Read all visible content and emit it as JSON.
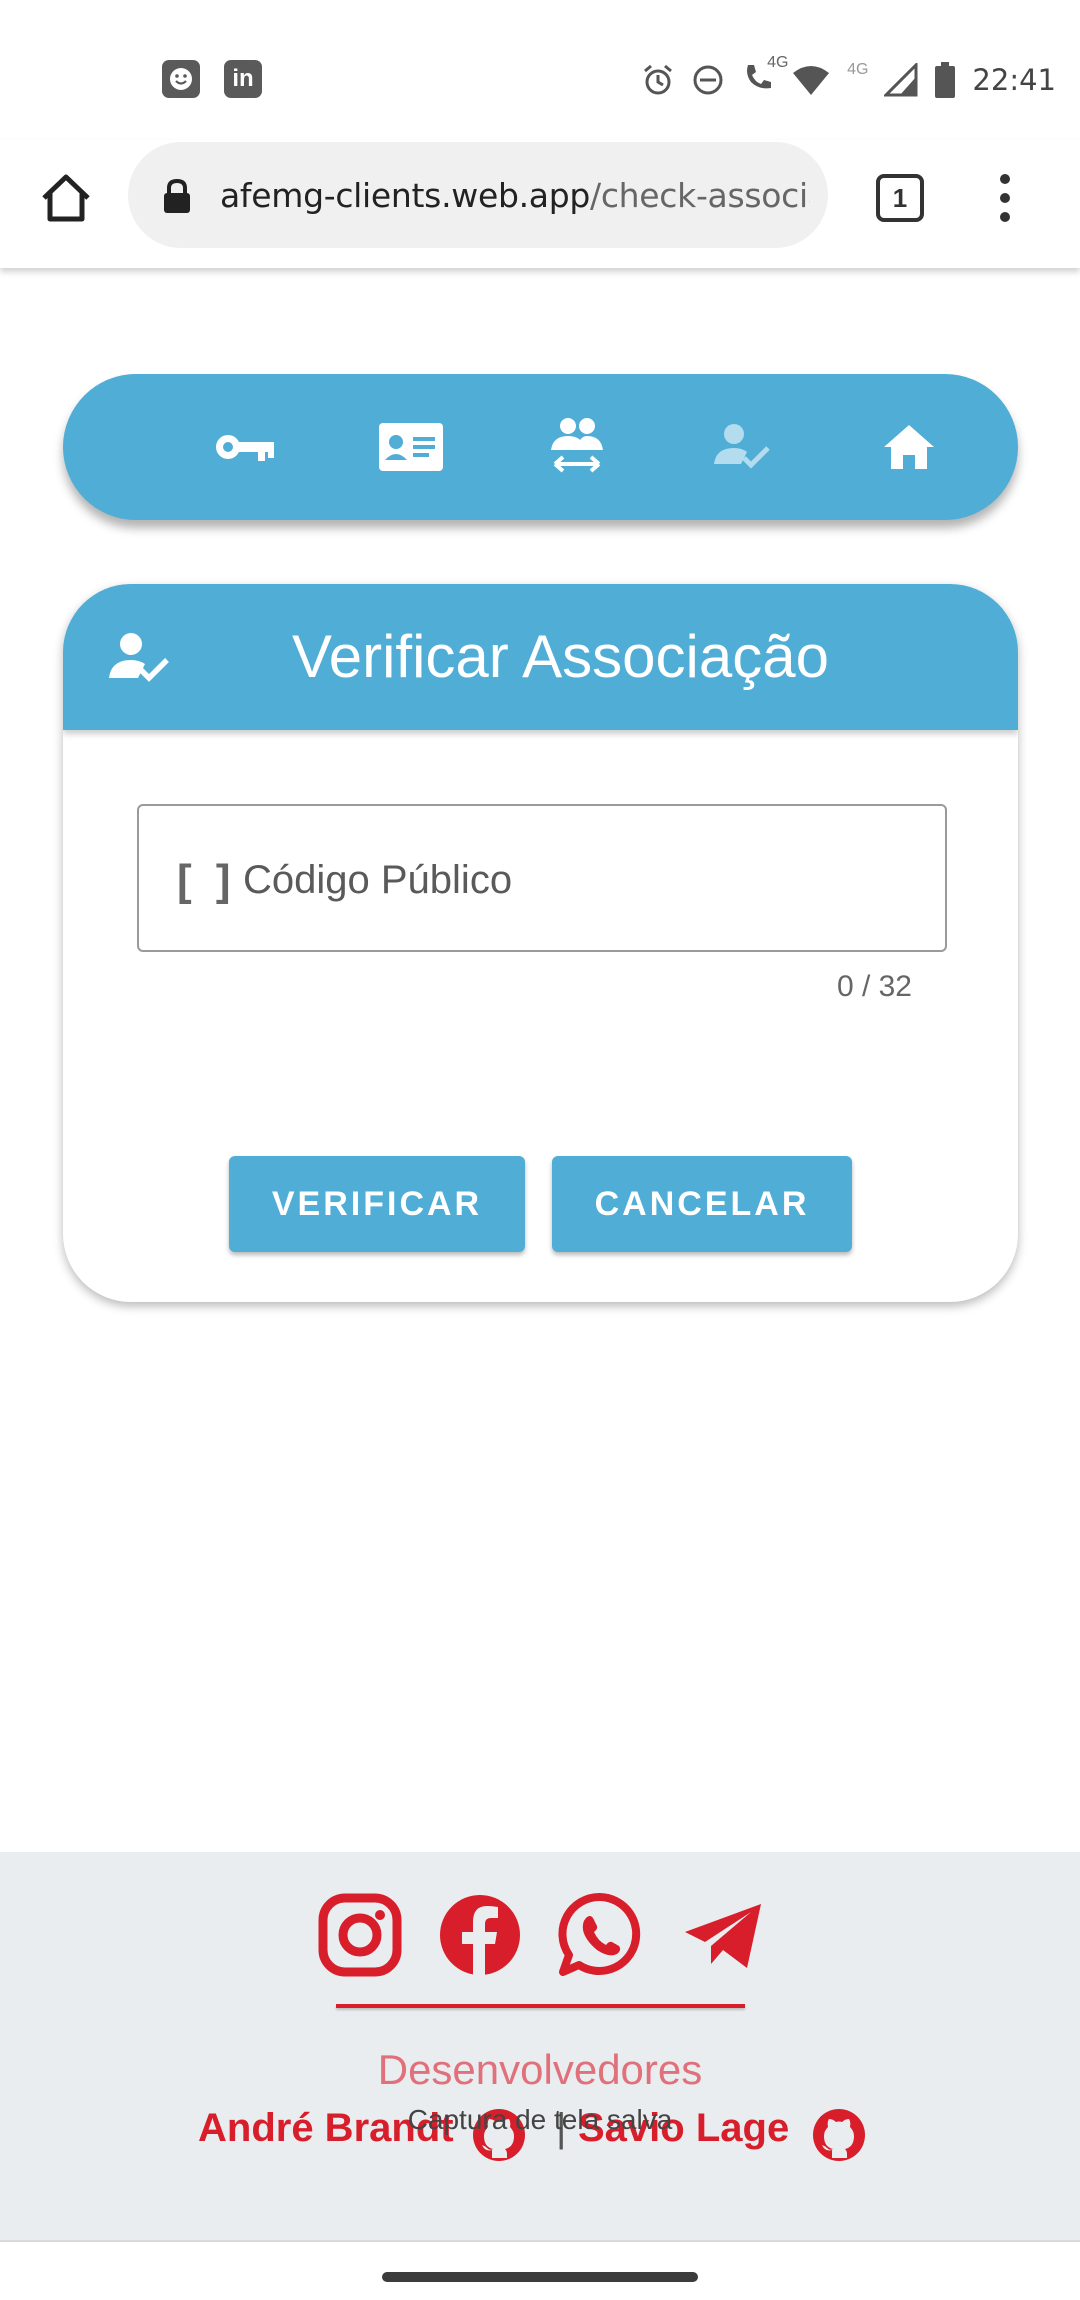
{
  "status_bar": {
    "time": "22:41",
    "network_label_1": "4G",
    "network_label_2": "4G",
    "app_icons": [
      "smiley-app-icon",
      "linkedin-icon"
    ],
    "linkedin_text": "in"
  },
  "browser": {
    "url_domain": "afemg-clients.web.app",
    "url_path": "/check-associat",
    "tab_count": "1"
  },
  "nav": {
    "items": [
      "key-icon",
      "id-card-icon",
      "people-swap-icon",
      "user-check-icon",
      "home-icon"
    ],
    "active_item": "user-check-icon"
  },
  "card": {
    "title": "Verificar Associação",
    "field": {
      "prefix": "[ ]",
      "placeholder": "Código Público",
      "value": "",
      "counter": "0 / 32"
    },
    "buttons": {
      "verify": "VERIFICAR",
      "cancel": "CANCELAR"
    }
  },
  "footer": {
    "social": [
      "instagram-icon",
      "facebook-icon",
      "whatsapp-icon",
      "telegram-icon"
    ],
    "heading": "Desenvolvedores",
    "developers": [
      "André Brandt",
      "Savio Lage"
    ],
    "separator": "|",
    "toast": "Captura de tela salva"
  },
  "colors": {
    "accent": "#4fadd6",
    "footer_red": "#d81e2a",
    "footer_bg": "#eaedf0"
  }
}
